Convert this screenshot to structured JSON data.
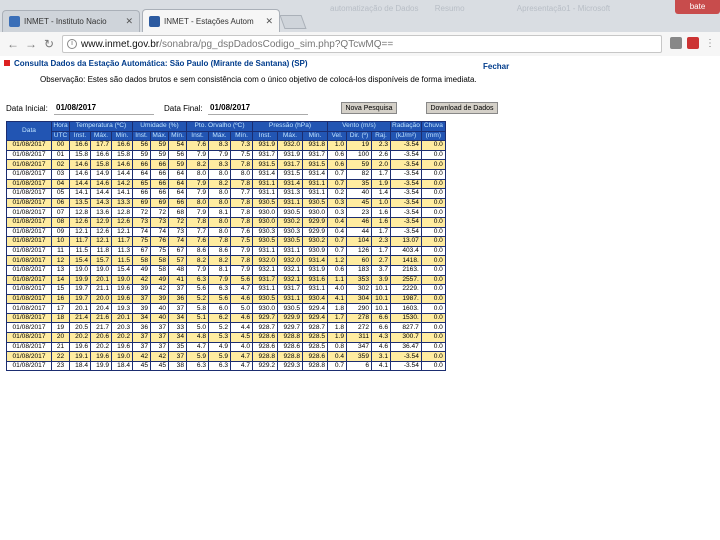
{
  "browser": {
    "tabs": [
      {
        "label": "INMET - Instituto Nacio",
        "favicon_color": "#3b6fb8",
        "active": false
      },
      {
        "label": "INMET - Estações Autom",
        "favicon_color": "#2c5aa0",
        "active": true
      }
    ],
    "window_title": "Apresentação1 - Microsoft PowerPoint (Falha na A…",
    "window_title_left": "automatização de Dados",
    "window_title_mid": "Resumo",
    "window_control_label": "bate",
    "url_host": "www.inmet.gov.br",
    "url_path": "/sonabra/pg_dspDadosCodigo_sim.php?QTcwMQ==",
    "accent_color": "#2255b3"
  },
  "page": {
    "title": "Consulta Dados da Estação Automática: São Paulo (Mirante de Santana) (SP)",
    "close_link": "Fechar",
    "observation": "Observação: Estes são dados brutos e sem consistência com o único objetivo de colocá-los disponíveis de forma imediata."
  },
  "date_filter": {
    "start_label": "Data Inicial:",
    "start_value": "01/08/2017",
    "end_label": "Data Final:",
    "end_value": "01/08/2017",
    "new_search_button": "Nova Pesquisa",
    "download_button": "Download de Dados"
  },
  "table": {
    "header_groups": [
      {
        "label": "Data",
        "span": 1,
        "rows": 2
      },
      {
        "label": "Hora",
        "span": 1,
        "rows": 1
      },
      {
        "label": "Temperatura (ºC)",
        "span": 3,
        "rows": 1
      },
      {
        "label": "Umidade (%)",
        "span": 3,
        "rows": 1
      },
      {
        "label": "Pto. Orvalho (ºC)",
        "span": 3,
        "rows": 1
      },
      {
        "label": "Pressão (hPa)",
        "span": 3,
        "rows": 1
      },
      {
        "label": "Vento (m/s)",
        "span": 3,
        "rows": 1
      },
      {
        "label": "Radiação",
        "span": 1,
        "rows": 1
      },
      {
        "label": "Chuva",
        "span": 1,
        "rows": 1
      }
    ],
    "sub_headers": [
      "UTC",
      "Inst.",
      "Máx.",
      "Mín.",
      "Inst.",
      "Máx.",
      "Mín.",
      "Inst.",
      "Máx.",
      "Mín.",
      "Inst.",
      "Máx.",
      "Mín.",
      "Vel.",
      "Dir. (º)",
      "Raj.",
      "(kJ/m²)",
      "(mm)"
    ],
    "rows": [
      [
        "01/08/2017",
        "00",
        "16.6",
        "17.7",
        "16.6",
        "56",
        "59",
        "54",
        "7.6",
        "8.3",
        "7.3",
        "931.9",
        "932.0",
        "931.8",
        "1.0",
        "19",
        "2.3",
        "-3.54",
        "0.0"
      ],
      [
        "01/08/2017",
        "01",
        "15.8",
        "16.6",
        "15.8",
        "59",
        "59",
        "56",
        "7.9",
        "7.9",
        "7.5",
        "931.7",
        "931.9",
        "931.7",
        "0.6",
        "100",
        "2.6",
        "-3.54",
        "0.0"
      ],
      [
        "01/08/2017",
        "02",
        "14.6",
        "15.8",
        "14.6",
        "66",
        "66",
        "59",
        "8.2",
        "8.3",
        "7.8",
        "931.5",
        "931.7",
        "931.5",
        "0.6",
        "59",
        "2.0",
        "-3.54",
        "0.0"
      ],
      [
        "01/08/2017",
        "03",
        "14.6",
        "14.9",
        "14.4",
        "64",
        "66",
        "64",
        "8.0",
        "8.0",
        "8.0",
        "931.4",
        "931.5",
        "931.4",
        "0.7",
        "82",
        "1.7",
        "-3.54",
        "0.0"
      ],
      [
        "01/08/2017",
        "04",
        "14.4",
        "14.6",
        "14.2",
        "65",
        "66",
        "64",
        "7.9",
        "8.2",
        "7.8",
        "931.1",
        "931.4",
        "931.1",
        "0.7",
        "35",
        "1.9",
        "-3.54",
        "0.0"
      ],
      [
        "01/08/2017",
        "05",
        "14.1",
        "14.4",
        "14.1",
        "66",
        "66",
        "64",
        "7.9",
        "8.0",
        "7.7",
        "931.1",
        "931.3",
        "931.1",
        "0.2",
        "40",
        "1.4",
        "-3.54",
        "0.0"
      ],
      [
        "01/08/2017",
        "06",
        "13.5",
        "14.3",
        "13.3",
        "69",
        "69",
        "66",
        "8.0",
        "8.0",
        "7.8",
        "930.5",
        "931.1",
        "930.5",
        "0.3",
        "45",
        "1.0",
        "-3.54",
        "0.0"
      ],
      [
        "01/08/2017",
        "07",
        "12.8",
        "13.6",
        "12.8",
        "72",
        "72",
        "68",
        "7.9",
        "8.1",
        "7.8",
        "930.0",
        "930.5",
        "930.0",
        "0.3",
        "23",
        "1.6",
        "-3.54",
        "0.0"
      ],
      [
        "01/08/2017",
        "08",
        "12.6",
        "12.9",
        "12.6",
        "73",
        "73",
        "72",
        "7.8",
        "8.0",
        "7.8",
        "930.0",
        "930.2",
        "929.9",
        "0.4",
        "46",
        "1.6",
        "-3.54",
        "0.0"
      ],
      [
        "01/08/2017",
        "09",
        "12.1",
        "12.6",
        "12.1",
        "74",
        "74",
        "73",
        "7.7",
        "8.0",
        "7.6",
        "930.3",
        "930.3",
        "929.9",
        "0.4",
        "44",
        "1.7",
        "-3.54",
        "0.0"
      ],
      [
        "01/08/2017",
        "10",
        "11.7",
        "12.1",
        "11.7",
        "75",
        "76",
        "74",
        "7.6",
        "7.8",
        "7.5",
        "930.5",
        "930.5",
        "930.2",
        "0.7",
        "104",
        "2.3",
        "13.07",
        "0.0"
      ],
      [
        "01/08/2017",
        "11",
        "11.5",
        "11.8",
        "11.3",
        "67",
        "75",
        "67",
        "8.6",
        "8.6",
        "7.9",
        "931.1",
        "931.1",
        "930.9",
        "0.7",
        "126",
        "1.7",
        "403.4",
        "0.0"
      ],
      [
        "01/08/2017",
        "12",
        "15.4",
        "15.7",
        "11.5",
        "58",
        "58",
        "57",
        "8.2",
        "8.2",
        "7.8",
        "932.0",
        "932.0",
        "931.4",
        "1.2",
        "60",
        "2.7",
        "1418.",
        "0.0"
      ],
      [
        "01/08/2017",
        "13",
        "19.0",
        "19.0",
        "15.4",
        "49",
        "58",
        "48",
        "7.9",
        "8.1",
        "7.9",
        "932.1",
        "932.1",
        "931.9",
        "0.6",
        "183",
        "3.7",
        "2163.",
        "0.0"
      ],
      [
        "01/08/2017",
        "14",
        "19.9",
        "20.1",
        "19.0",
        "42",
        "49",
        "41",
        "6.3",
        "7.9",
        "5.6",
        "931.7",
        "932.1",
        "931.6",
        "1.1",
        "353",
        "3.9",
        "2557.",
        "0.0"
      ],
      [
        "01/08/2017",
        "15",
        "19.7",
        "21.1",
        "19.6",
        "39",
        "42",
        "37",
        "5.6",
        "6.3",
        "4.7",
        "931.1",
        "931.7",
        "931.1",
        "4.0",
        "302",
        "10.1",
        "2229.",
        "0.0"
      ],
      [
        "01/08/2017",
        "16",
        "19.7",
        "20.0",
        "19.6",
        "37",
        "39",
        "36",
        "5.2",
        "5.6",
        "4.6",
        "930.5",
        "931.1",
        "930.4",
        "4.1",
        "304",
        "10.1",
        "1987.",
        "0.0"
      ],
      [
        "01/08/2017",
        "17",
        "20.1",
        "20.4",
        "19.3",
        "39",
        "40",
        "37",
        "5.8",
        "6.0",
        "5.0",
        "930.0",
        "930.5",
        "929.4",
        "1.8",
        "290",
        "10.1",
        "1603.",
        "0.0"
      ],
      [
        "01/08/2017",
        "18",
        "21.4",
        "21.6",
        "20.1",
        "34",
        "40",
        "34",
        "5.1",
        "6.2",
        "4.6",
        "929.7",
        "929.9",
        "929.4",
        "1.7",
        "278",
        "6.6",
        "1530.",
        "0.0"
      ],
      [
        "01/08/2017",
        "19",
        "20.5",
        "21.7",
        "20.3",
        "36",
        "37",
        "33",
        "5.0",
        "5.2",
        "4.4",
        "928.7",
        "929.7",
        "928.7",
        "1.8",
        "272",
        "6.6",
        "827.7",
        "0.0"
      ],
      [
        "01/08/2017",
        "20",
        "20.2",
        "20.6",
        "20.2",
        "37",
        "37",
        "34",
        "4.8",
        "5.3",
        "4.5",
        "928.6",
        "928.8",
        "928.5",
        "1.9",
        "311",
        "4.3",
        "300.7",
        "0.0"
      ],
      [
        "01/08/2017",
        "21",
        "19.6",
        "20.2",
        "19.6",
        "37",
        "37",
        "35",
        "4.7",
        "4.9",
        "4.0",
        "928.6",
        "928.6",
        "928.5",
        "0.8",
        "347",
        "4.6",
        "36.47",
        "0.0"
      ],
      [
        "01/08/2017",
        "22",
        "19.1",
        "19.6",
        "19.0",
        "42",
        "42",
        "37",
        "5.9",
        "5.9",
        "4.7",
        "928.8",
        "928.8",
        "928.6",
        "0.4",
        "359",
        "3.1",
        "-3.54",
        "0.0"
      ],
      [
        "01/08/2017",
        "23",
        "18.4",
        "19.9",
        "18.4",
        "45",
        "45",
        "38",
        "6.3",
        "6.3",
        "4.7",
        "929.2",
        "929.3",
        "928.8",
        "0.7",
        "6",
        "4.1",
        "-3.54",
        "0.0"
      ]
    ]
  }
}
